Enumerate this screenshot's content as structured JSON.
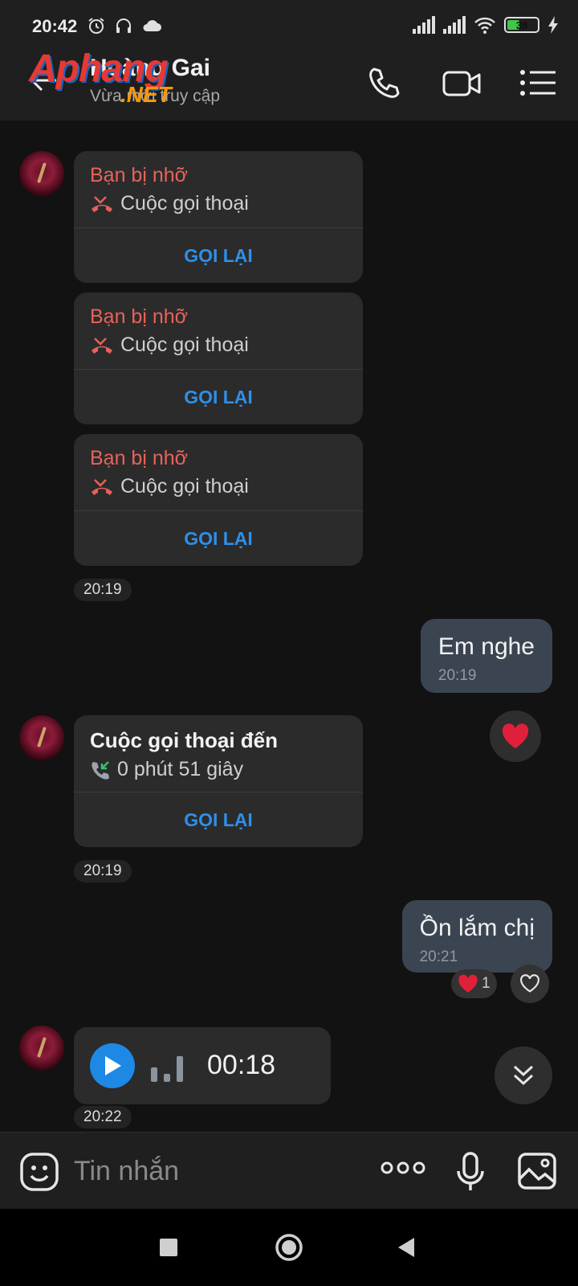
{
  "status_bar": {
    "time": "20:42",
    "battery": "38"
  },
  "header": {
    "contact_name": "Hoàng Gai",
    "contact_status": "Vừa mới truy cập",
    "watermark_brand": "Aphang",
    "watermark_sub": ".NET"
  },
  "messages": {
    "missed_calls": [
      {
        "title": "Bạn bị nhỡ",
        "call_type": "Cuộc gọi thoại",
        "action": "GỌI LẠI"
      },
      {
        "title": "Bạn bị nhỡ",
        "call_type": "Cuộc gọi thoại",
        "action": "GỌI LẠI"
      },
      {
        "title": "Bạn bị nhỡ",
        "call_type": "Cuộc gọi thoại",
        "action": "GỌI LẠI"
      }
    ],
    "missed_time": "20:19",
    "out1": {
      "text": "Em nghe",
      "time": "20:19"
    },
    "incoming_call": {
      "title": "Cuộc gọi thoại đến",
      "duration": "0 phút 51 giây",
      "action": "GỌI LẠI"
    },
    "incoming_time": "20:19",
    "out2": {
      "text": "Ồn lắm chị",
      "time": "20:21",
      "reaction_count": "1"
    },
    "voice": {
      "duration": "00:18"
    },
    "voice_time": "20:22"
  },
  "input": {
    "placeholder": "Tin nhắn"
  },
  "colors": {
    "accent": "#2f8fe9",
    "missed": "#e8625b",
    "outgoing_bubble": "#3b4552",
    "card": "#2b2b2b"
  }
}
